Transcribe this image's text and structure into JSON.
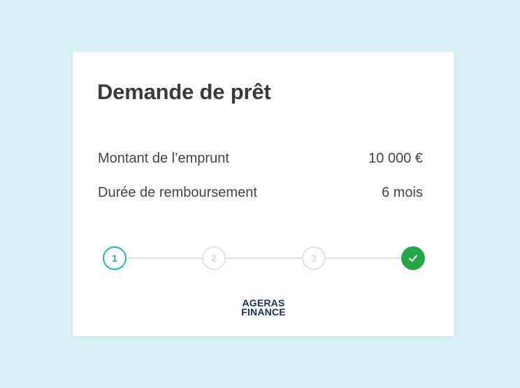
{
  "card": {
    "title": "Demande de prêt",
    "details": [
      {
        "label": "Montant de l’emprunt",
        "value": "10 000 €"
      },
      {
        "label": "Durée de remboursement",
        "value": "6 mois"
      }
    ]
  },
  "stepper": {
    "steps": [
      {
        "label": "1",
        "state": "active"
      },
      {
        "label": "2",
        "state": "pending"
      },
      {
        "label": "3",
        "state": "pending"
      },
      {
        "label": "",
        "state": "done",
        "icon": "check-icon"
      }
    ]
  },
  "brand": {
    "line1": "AGERAS",
    "line2": "FINANCE"
  },
  "colors": {
    "background": "#d8f1f5",
    "active_step": "#24b3bd",
    "done_step": "#27a745",
    "brand": "#1a2f5c"
  }
}
